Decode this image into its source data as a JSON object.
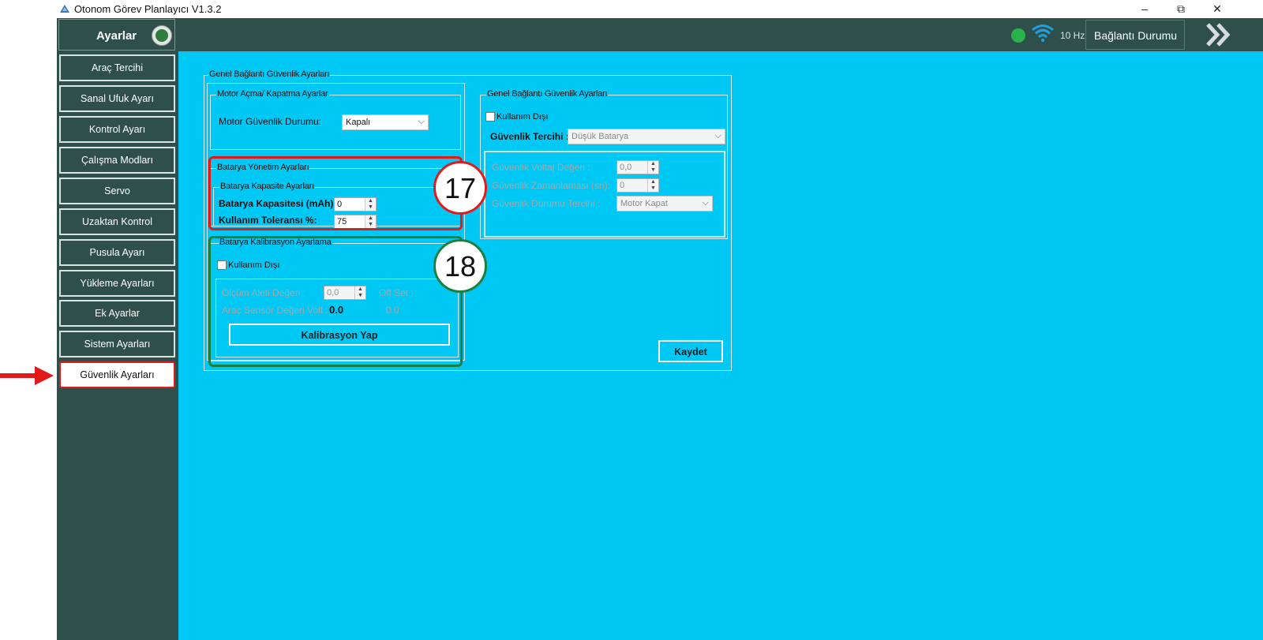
{
  "window": {
    "title": "Otonom Görev Planlayıcı V1.3.2",
    "minimize": "–",
    "maximize": "⧉",
    "close": "✕"
  },
  "header": {
    "section_title": "Ayarlar",
    "hz": "10 Hz",
    "connection_label": "Bağlantı Durumu",
    "status_color": "#29b34a"
  },
  "sidebar": {
    "items": [
      {
        "label": "Araç Tercihi"
      },
      {
        "label": "Sanal Ufuk Ayarı"
      },
      {
        "label": "Kontrol Ayarı"
      },
      {
        "label": "Çalışma Modları"
      },
      {
        "label": "Servo"
      },
      {
        "label": "Uzaktan Kontrol"
      },
      {
        "label": "Pusula Ayarı"
      },
      {
        "label": "Yükleme Ayarları"
      },
      {
        "label": "Ek Ayarlar"
      },
      {
        "label": "Sistem Ayarları"
      },
      {
        "label": "Güvenlik Ayarları"
      }
    ],
    "active_index": 10
  },
  "main": {
    "outer_legend": "Genel Bağlantı Güvenlik Ayarları",
    "motor": {
      "legend": "Motor Açma/ Kapatma Ayarlar",
      "label": "Motor Güvenlik Durumu:",
      "value": "Kapalı"
    },
    "battery": {
      "legend": "Batarya Yönetim Ayarları",
      "capacity_legend": "Batarya Kapasite Ayarları",
      "capacity_label": "Batarya Kapasitesi (mAh) :",
      "capacity_value": "0",
      "tolerance_label": "Kullanım Toleransı %:",
      "tolerance_value": "75"
    },
    "calibration": {
      "legend": "Batarya Kalibrasyon Ayarlama",
      "disabled_label": "Kullanım Dışı",
      "meter_label": "Ölçüm Aleti Değeri :",
      "meter_value": "0,0",
      "offset_label": "Off Set :",
      "sensor_label": "Araç Sensör Değeri Volt :",
      "sensor_value": "0.0",
      "offset_value": "0.0",
      "button": "Kalibrasyon Yap"
    },
    "connection": {
      "legend": "Genel Bağlantı Güvenlik Ayarları",
      "disabled_label": "Kullanım Dışı",
      "pref_label": "Güvenlik Tercihi :",
      "pref_value": "Düşük Batarya",
      "voltage_label": "Güvenlik Voltaj Değeri :",
      "voltage_value": "0,0",
      "timing_label": "Güvenlik Zamanlaması (sn):",
      "timing_value": "0",
      "state_label": "Güvenlik Durumu Tercihi :",
      "state_value": "Motor Kapat"
    },
    "save_button": "Kaydet"
  },
  "annotations": {
    "callout_17": "17",
    "callout_18": "18"
  },
  "icons": {
    "app": "drone-icon",
    "wifi": "wifi-icon",
    "next": "double-chevron-right-icon"
  }
}
